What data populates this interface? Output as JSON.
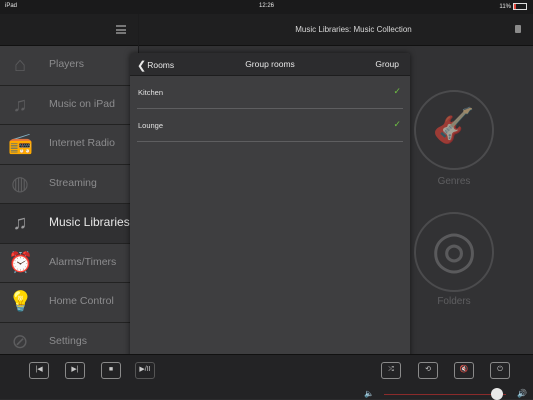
{
  "status_bar": {
    "left": "iPad",
    "time": "12:26",
    "battery": "11%"
  },
  "header": {
    "title": "Music Libraries: Music Collection"
  },
  "sidebar": {
    "items": [
      {
        "label": "Players",
        "icon": "home-icon",
        "glyph": "⌂"
      },
      {
        "label": "Music on iPad",
        "icon": "music-note-icon",
        "glyph": "♫"
      },
      {
        "label": "Internet Radio",
        "icon": "radio-icon",
        "glyph": "📻"
      },
      {
        "label": "Streaming",
        "icon": "globe-icon",
        "glyph": "◍"
      },
      {
        "label": "Music Libraries",
        "icon": "music-note-icon",
        "glyph": "♫"
      },
      {
        "label": "Alarms/Timers",
        "icon": "alarm-clock-icon",
        "glyph": "⏰"
      },
      {
        "label": "Home Control",
        "icon": "lightbulb-icon",
        "glyph": "💡"
      },
      {
        "label": "Settings",
        "icon": "settings-icon",
        "glyph": "⊘"
      }
    ],
    "active_index": 4
  },
  "content": {
    "tiles": [
      {
        "label": "Genres",
        "icon": "guitar-icon",
        "glyph": "🎸"
      },
      {
        "label": "Folders",
        "icon": "target-icon",
        "glyph": "◎"
      }
    ]
  },
  "popover": {
    "back_label": "Rooms",
    "title": "Group rooms",
    "action_label": "Group",
    "rooms": [
      {
        "name": "Kitchen",
        "checked": true
      },
      {
        "name": "Lounge",
        "checked": true
      }
    ],
    "check_glyph": "✓",
    "check_color": "#6fc043"
  },
  "transport": {
    "prev_glyph": "|◀",
    "next_glyph": "▶|",
    "stop_glyph": "■",
    "playpause_glyph": "▶/II",
    "shuffle_glyph": "⤮",
    "repeat_glyph": "⟲",
    "mute_glyph": "🔇",
    "power_glyph": "⏻",
    "volume_low_glyph": "🔈",
    "volume_high_glyph": "🔊",
    "volume_level": 0.93
  }
}
